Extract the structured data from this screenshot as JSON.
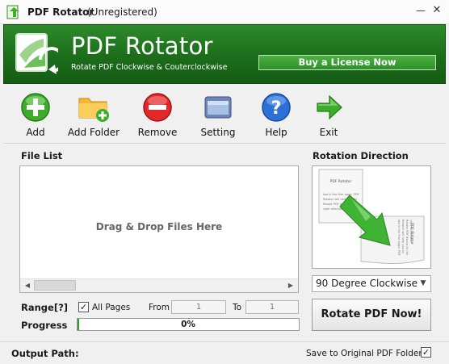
{
  "window": {
    "app_name": "PDF Rotator",
    "state": "(Unregistered)",
    "minimize_glyph": "—",
    "close_glyph": "✕"
  },
  "banner": {
    "title": "PDF Rotator",
    "subtitle": "Rotate PDF Clockwise & Couterclockwise",
    "buy_label": "Buy a License Now",
    "background_color": "#1c6d1b"
  },
  "toolbar": {
    "add": "Add",
    "add_folder": "Add Folder",
    "remove": "Remove",
    "setting": "Setting",
    "help": "Help",
    "exit": "Exit"
  },
  "file_list": {
    "label": "File List",
    "placeholder": "Drag & Drop Files Here"
  },
  "range": {
    "label": "Range[?]",
    "all_pages_label": "All Pages",
    "all_pages_checked": true,
    "from_label": "From",
    "from_value": "1",
    "to_label": "To",
    "to_value": "1"
  },
  "progress": {
    "label": "Progress",
    "text": "0%",
    "value": 0
  },
  "rotation": {
    "label": "Rotation Direction",
    "selected": "90 Degree Clockwise",
    "rotate_button": "Rotate PDF Now!",
    "preview_page_title": "PDF Rotator",
    "preview_page_body": [
      "Iwe is the first page. PDF",
      "Rotator will help you to",
      "Rotate PDF dwcus to the",
      "right directions."
    ]
  },
  "footer": {
    "output_label": "Output Path:",
    "save_original_label": "Save to Original PDF Folder",
    "save_original_checked": true
  }
}
